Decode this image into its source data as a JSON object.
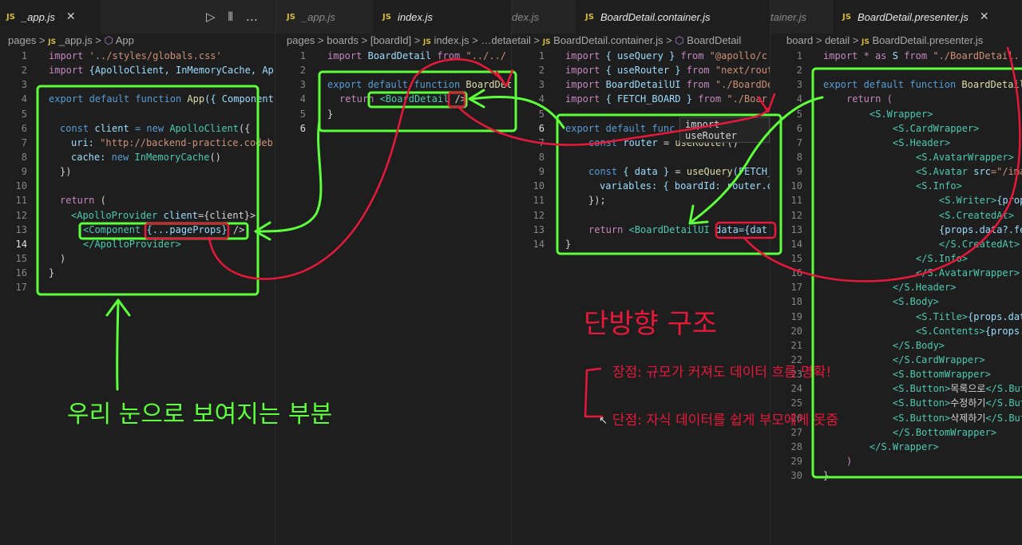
{
  "colors": {
    "green": "#5cff3a",
    "red": "#e8183a",
    "editor_bg": "#1e1e1e",
    "tab_bg": "#252526",
    "js_badge": "#d7ba3b"
  },
  "icons": {
    "run": "play-icon",
    "split": "split-editor-icon",
    "more": "more-icon",
    "close": "close-icon"
  },
  "pane1": {
    "tab": {
      "badge": "JS",
      "name": "_app.js",
      "close": "✕"
    },
    "actions": {
      "run": "▷",
      "split": "⫴",
      "more": "…"
    },
    "breadcrumb": [
      "pages",
      "_app.js",
      "App"
    ],
    "lines": [
      "1",
      "2",
      "3",
      "4",
      "5",
      "6",
      "7",
      "8",
      "9",
      "10",
      "11",
      "12",
      "13",
      "14",
      "15",
      "16",
      "17"
    ],
    "code": {
      "l1a": "import",
      "l1b": "'../styles/globals.css'",
      "l2a": "import",
      "l2b": "{ApolloClient, InMemoryCache, Ap",
      "l4a": "export default function",
      "l4b": "App",
      "l4c": "({ Component",
      "l6a": "const",
      "l6b": "client",
      "l6c": "= new",
      "l6d": "ApolloClient",
      "l6e": "({",
      "l7a": "uri:",
      "l7b": "\"http://backend-practice.codeb",
      "l8a": "cache:",
      "l8b": "new",
      "l8c": "InMemoryCache",
      "l8d": "()",
      "l9": "})",
      "l11a": "return",
      "l11b": "(",
      "l12a": "<ApolloProvider",
      "l12b": "client",
      "l12c": "={client}>",
      "l13a": "<Component",
      "l13b": "{...pageProps}",
      "l13c": "/>",
      "l14": "</ApolloProvider>",
      "l15": ")",
      "l16": "}"
    }
  },
  "pane2": {
    "tabs": [
      {
        "badge": "JS",
        "name": "_app.js"
      },
      {
        "badge": "JS",
        "name": "index.js"
      }
    ],
    "breadcrumb": [
      "pages",
      "boards",
      "[boardId]",
      "index.js",
      "…detail"
    ],
    "lines": [
      "1",
      "2",
      "3",
      "4",
      "5",
      "6"
    ],
    "code": {
      "l1a": "import",
      "l1b": "BoardDetail",
      "l1c": "from",
      "l1d": "\"../../",
      "l3a": "export default function",
      "l3b": "BoardDet",
      "l4a": "return",
      "l4b": "<BoardDetail",
      "l4c": "/>",
      "l5": "}"
    }
  },
  "pane3": {
    "tabs": [
      {
        "name": "dex.js"
      },
      {
        "badge": "JS",
        "name": "BoardDetail.container.js"
      }
    ],
    "breadcrumb": [
      "etail",
      "BoardDetail.container.js",
      "BoardDetail"
    ],
    "lines": [
      "1",
      "2",
      "3",
      "4",
      "5",
      "6",
      "7",
      "8",
      "9",
      "10",
      "11",
      "12",
      "13",
      "14"
    ],
    "tooltip": "import useRouter",
    "code": {
      "l1a": "import",
      "l1b": "{ useQuery }",
      "l1c": "from",
      "l1d": "\"@apollo/c",
      "l2a": "import",
      "l2b": "{ useRouter }",
      "l2c": "from",
      "l2d": "\"next/rout",
      "l3a": "import",
      "l3b": "BoardDetailUI",
      "l3c": "from",
      "l3d": "\"./BoardDe",
      "l4a": "import",
      "l4b": "{ FETCH_BOARD }",
      "l4c": "from",
      "l4d": "\"./Boar",
      "l6a": "export default",
      "l6b": "func",
      "l7a": "const",
      "l7b": "router",
      "l7c": "=",
      "l7d": "useRouter",
      "l7e": "()",
      "l9a": "const",
      "l9b": "{ data }",
      "l9c": "=",
      "l9d": "useQuery",
      "l9e": "(FETCH_",
      "l10a": "variables:",
      "l10b": "{ boardId:",
      "l10c": "router.c",
      "l11": "});",
      "l13a": "return",
      "l13b": "<BoardDetailUI",
      "l13c": "data",
      "l13d": "={dat",
      "l14": "}"
    }
  },
  "pane4": {
    "tabs": [
      {
        "name": "tainer.js"
      },
      {
        "badge": "JS",
        "name": "BoardDetail.presenter.js",
        "close": "✕"
      }
    ],
    "breadcrumb": [
      "board",
      "detail",
      "BoardDetail.presenter.js"
    ],
    "lines": [
      "1",
      "2",
      "3",
      "4",
      "5",
      "6",
      "7",
      "8",
      "9",
      "10",
      "11",
      "12",
      "13",
      "14",
      "15",
      "16",
      "17",
      "18",
      "19",
      "20",
      "21",
      "22",
      "23",
      "24",
      "25",
      "26",
      "27",
      "28",
      "29",
      "30"
    ],
    "code": {
      "l1a": "import * as",
      "l1b": "S",
      "l1c": "from",
      "l1d": "\"./BoardDetail.",
      "l3a": "export default function",
      "l3b": "BoardDetailT",
      "l4": "return (",
      "l5": "<S.Wrapper>",
      "l6": "<S.CardWrapper>",
      "l7": "<S.Header>",
      "l8": "<S.AvatarWrapper>",
      "l9a": "<S.Avatar",
      "l9b": "src",
      "l9c": "=\"/ima",
      "l10": "<S.Info>",
      "l11a": "<S.Writer>",
      "l11b": "{props",
      "l12": "<S.CreatedAt>",
      "l13": "{props.data?.fe",
      "l14": "</S.CreatedAt>",
      "l15": "</S.Info>",
      "l16": "</S.AvatarWrapper>",
      "l17": "</S.Header>",
      "l18": "<S.Body>",
      "l19a": "<S.Title>",
      "l19b": "{props.dat",
      "l20a": "<S.Contents>",
      "l20b": "{props.",
      "l21": "</S.Body>",
      "l22": "</S.CardWrapper>",
      "l23": "<S.BottomWrapper>",
      "l24a": "<S.Button>",
      "l24b": "목록으로",
      "l24c": "</S.But",
      "l25a": "<S.Button>",
      "l25b": "수정하기",
      "l25c": "</S.But",
      "l26a": "<S.Button>",
      "l26b": "삭제하기",
      "l26c": "</S.But",
      "l27": "</S.BottomWrapper>",
      "l28": "</S.Wrapper>",
      "l29": ")",
      "l30": "}"
    }
  },
  "annotations": {
    "visible_part": "우리 눈으로 보여지는 부분",
    "one_way": "단방향 구조",
    "pro": "장점: 규모가 커져도 데이터 흐름 명확!",
    "con": "단점: 자식 데이터를 쉽게 부모에게 못줌"
  }
}
